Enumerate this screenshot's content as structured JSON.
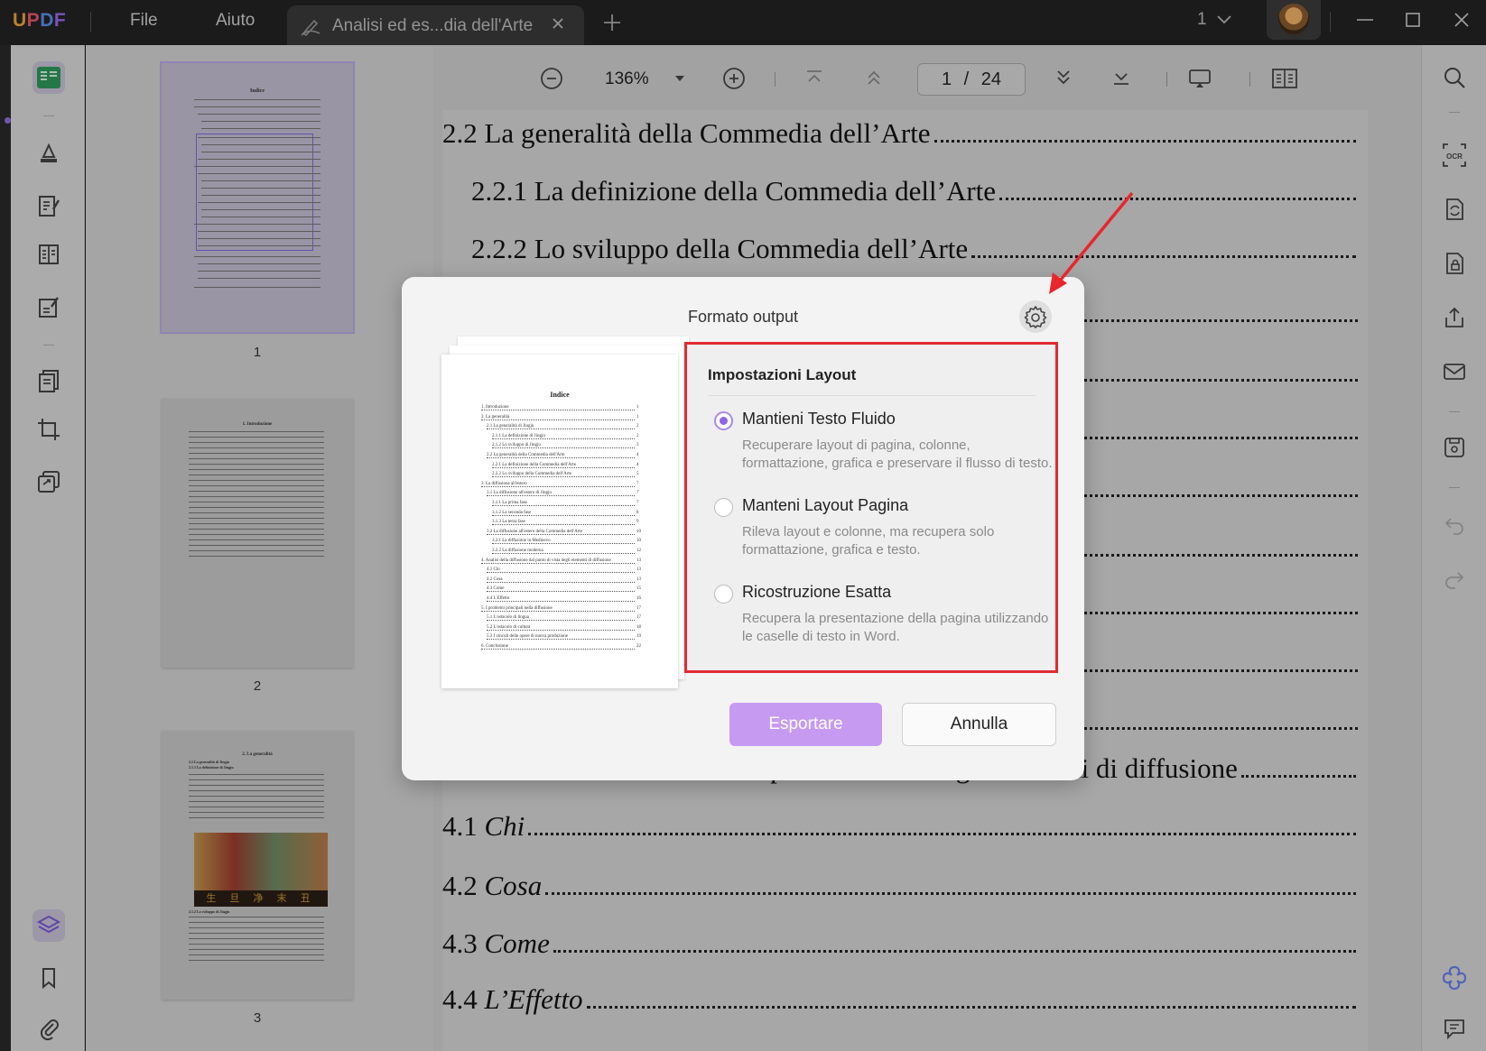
{
  "app": {
    "logo": "UPDF",
    "menu_file": "File",
    "menu_help": "Aiuto"
  },
  "tab": {
    "title": "Analisi ed es...dia dell'Arte"
  },
  "window": {
    "page_indicator": "1"
  },
  "toolbar": {
    "zoom": "136%",
    "current_page": "1",
    "page_sep": "/",
    "total_pages": "24"
  },
  "thumbnails": [
    {
      "label": "1"
    },
    {
      "label": "2"
    },
    {
      "label": "3"
    }
  ],
  "thumb_text": {
    "p1_title": "Indice",
    "p2_title": "1. Introduzione",
    "p3_title": "2. La generalità",
    "p3_sub1": "2.1 La generalità di Jingju",
    "p3_sub2": "2.1.1 La definizione di Jingju",
    "p3_sub3": "2.1.2 Lo sviluppo di Jingju",
    "p3_caption": "生 旦 净 末 丑"
  },
  "document": {
    "toc": [
      {
        "text": "2.2 La generalità della Commedia dell’Arte"
      },
      {
        "text": "2.2.1 La definizione della Commedia dell’Arte"
      },
      {
        "text": "2.2.2 Lo sviluppo della Commedia dell’Arte"
      },
      {
        "text": "4. Analisi della diffusione dal punto di vista degli elementi di diffusione"
      },
      {
        "num": "4.1",
        "text": "Chi"
      },
      {
        "num": "4.2",
        "text": "Cosa"
      },
      {
        "num": "4.3",
        "text": "Come"
      },
      {
        "num": "4.4",
        "text": "L’Effetto"
      }
    ]
  },
  "dialog": {
    "title": "Formato output",
    "layout_heading": "Impostazioni Layout",
    "options": [
      {
        "title": "Mantieni Testo Fluido",
        "desc": "Recuperare layout di pagina, colonne, formattazione, grafica e preservare il flusso di testo.",
        "selected": true
      },
      {
        "title": "Manteni Layout Pagina",
        "desc": "Rileva layout e colonne, ma recupera solo formattazione, grafica e testo.",
        "selected": false
      },
      {
        "title": "Ricostruzione Esatta",
        "desc": "Recupera la presentazione della pagina utilizzando le caselle di testo in Word.",
        "selected": false
      }
    ],
    "export_label": "Esportare",
    "cancel_label": "Annulla",
    "preview": {
      "title": "Indice",
      "entries": [
        "1. Introduzione",
        "2. La generalità",
        "2.1 La generalità di Jingju",
        "2.1.1 La definizione di Jingju",
        "2.1.2 Lo sviluppo di Jingju",
        "2.2 La generalità della Commedia dell'Arte",
        "2.2.1 La definizione della Commedia dell'Arte",
        "2.2.2 Lo sviluppo della Commedia dell'Arte",
        "3. La diffusione all'estero",
        "3.1 La diffusione all'estero di Jingju",
        "3.1.1 La prima fase",
        "3.1.2 La seconda fase",
        "3.1.3 La terza fase",
        "3.2 La diffusione all'estero della Commedia dell'Arte",
        "3.2.1 La diffusione in Medioevo",
        "3.2.2 La diffusione moderna",
        "4. Analisi della diffusione dal punto di vista degli elementi di diffusione",
        "4.1 Chi",
        "4.2 Cosa",
        "4.3 Come",
        "4.4 L'Effetto",
        "5. I problemi principali nella diffusione",
        "5.1 L'ostacolo di lingua",
        "5.2 L'ostacolo di cultura",
        "5.3 I vincoli delle opere di nuova produzione",
        "6. Conclusione"
      ],
      "pages": [
        "1",
        "1",
        "2",
        "2",
        "3",
        "4",
        "4",
        "5",
        "7",
        "7",
        "7",
        "8",
        "9",
        "10",
        "10",
        "12",
        "13",
        "13",
        "13",
        "15",
        "16",
        "17",
        "17",
        "18",
        "19",
        "22"
      ]
    }
  },
  "colors": {
    "accent": "#8e63e8",
    "export_button": "#c79af2",
    "highlight_box": "#e02a33"
  }
}
